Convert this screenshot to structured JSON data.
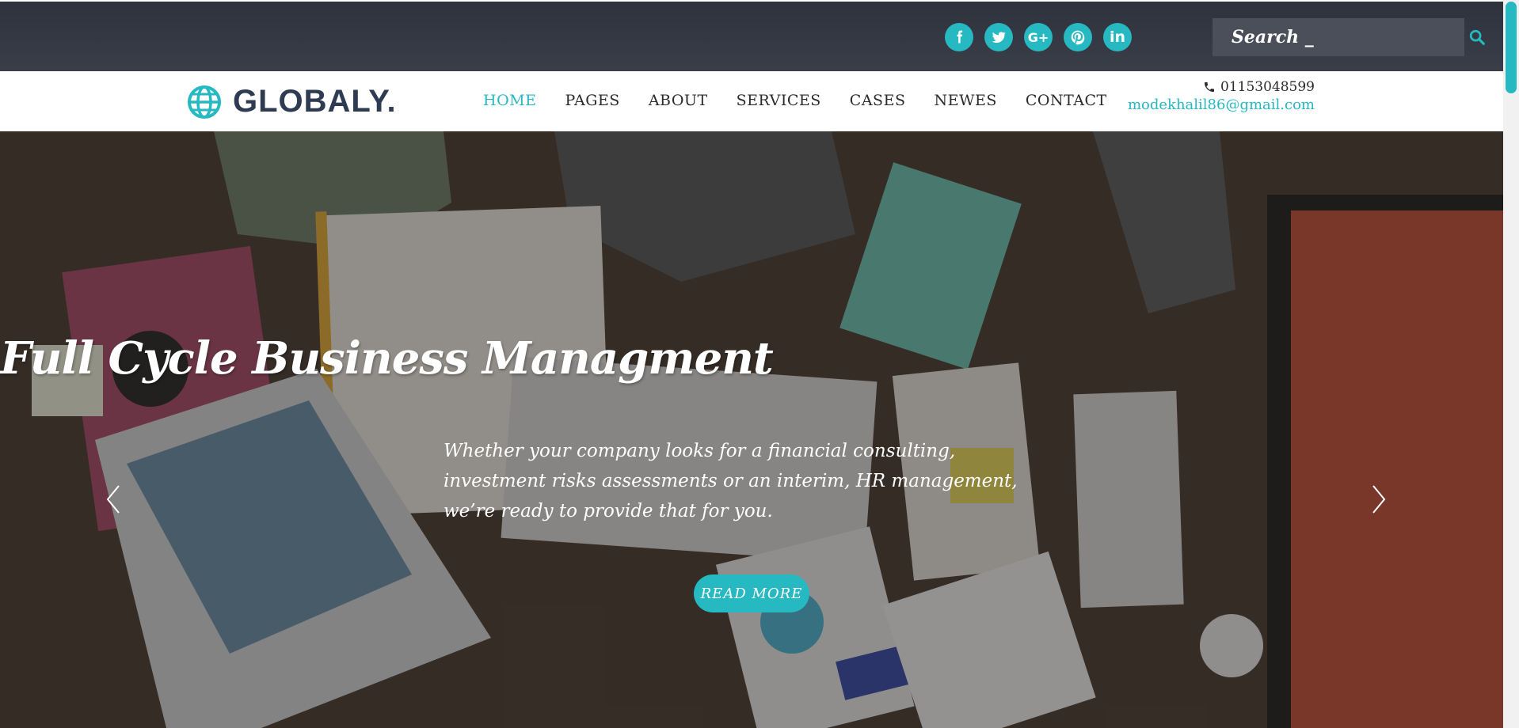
{
  "topbar": {
    "social": [
      {
        "name": "facebook",
        "icon": "facebook-icon"
      },
      {
        "name": "twitter",
        "icon": "twitter-icon"
      },
      {
        "name": "google-plus",
        "icon": "google-plus-icon",
        "glyph": "G+"
      },
      {
        "name": "pinterest",
        "icon": "pinterest-icon"
      },
      {
        "name": "linkedin",
        "icon": "linkedin-icon",
        "glyph": "in"
      }
    ],
    "search": {
      "placeholder": "Search _",
      "icon": "search-icon"
    }
  },
  "navbar": {
    "logo_text": "GLOBALY.",
    "logo_icon": "globe-icon",
    "items": [
      {
        "label": "HOME",
        "active": true
      },
      {
        "label": "PAGES"
      },
      {
        "label": "ABOUT"
      },
      {
        "label": "SERVICES"
      },
      {
        "label": "CASES"
      },
      {
        "label": "NEWES"
      },
      {
        "label": "CONTACT"
      }
    ],
    "phone": "01153048599",
    "email": "modekhalil86@gmail.com"
  },
  "hero": {
    "title": "Full Cycle Business Managment",
    "text": "Whether your company looks for a financial consulting, investment risks assessments or an interim, HR management, we’re ready to provide that for you.",
    "button": "READ MORE",
    "prev_icon": "chevron-left-icon",
    "next_icon": "chevron-right-icon"
  },
  "colors": {
    "accent": "#26b9c2",
    "topbar": "#33373f",
    "dark_text": "#2e3b52"
  }
}
